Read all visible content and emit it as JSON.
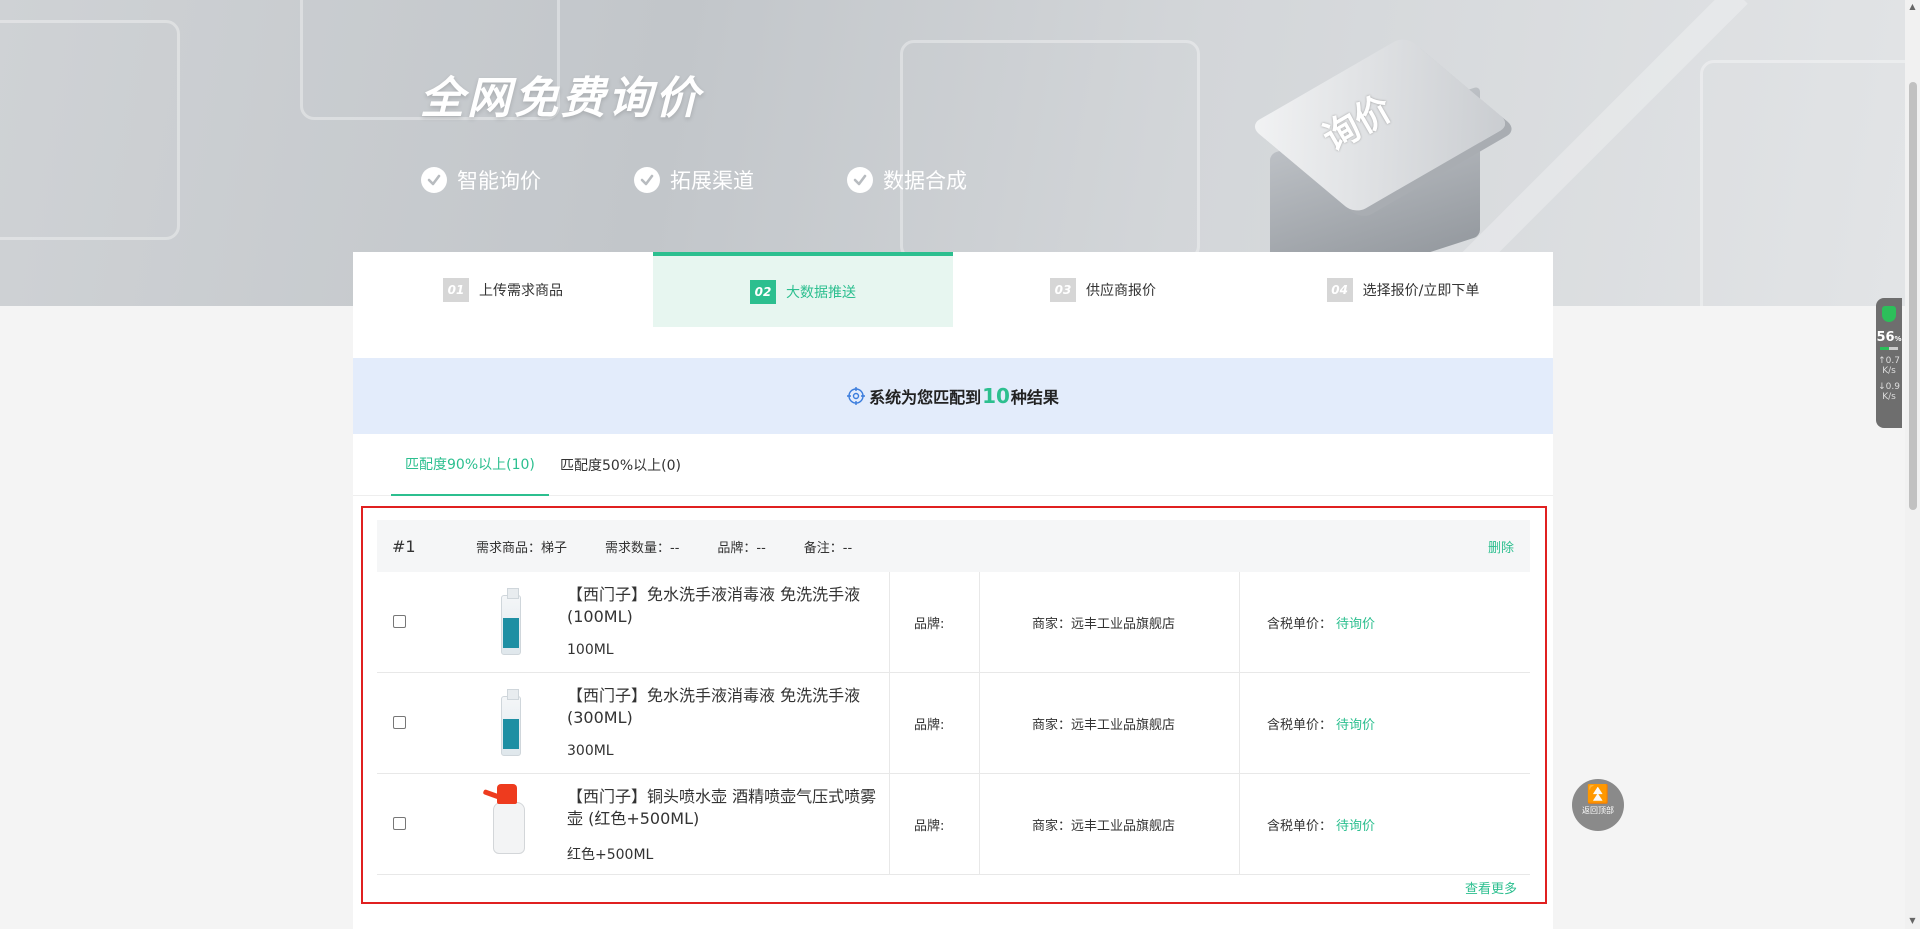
{
  "banner": {
    "title": "全网免费询价",
    "features": [
      "智能询价",
      "拓展渠道",
      "数据合成"
    ],
    "chip_label": "询价"
  },
  "steps": [
    {
      "num": "01",
      "label": "上传需求商品",
      "active": false
    },
    {
      "num": "02",
      "label": "大数据推送",
      "active": true
    },
    {
      "num": "03",
      "label": "供应商报价",
      "active": false
    },
    {
      "num": "04",
      "label": "选择报价/立即下单",
      "active": false
    }
  ],
  "match": {
    "prefix": "系统为您匹配到",
    "count": "10",
    "suffix": "种结果"
  },
  "tabs": [
    {
      "label": "匹配度90%以上(10)",
      "active": true
    },
    {
      "label": "匹配度50%以上(0)",
      "active": false
    }
  ],
  "request": {
    "index": "#1",
    "product": "需求商品：梯子",
    "quantity": "需求数量：--",
    "brand": "品牌：--",
    "note": "备注：--",
    "delete_label": "删除"
  },
  "products": [
    {
      "title": "【西门子】免水洗手液消毒液 免洗洗手液(100ML)",
      "spec": "100ML",
      "brand": "品牌:",
      "merchant": "商家：远丰工业品旗舰店",
      "price_label": "含税单价：",
      "price_value": "待询价",
      "image": "sanitizer-bottle"
    },
    {
      "title": "【西门子】免水洗手液消毒液 免洗洗手液(300ML)",
      "spec": "300ML",
      "brand": "品牌:",
      "merchant": "商家：远丰工业品旗舰店",
      "price_label": "含税单价：",
      "price_value": "待询价",
      "image": "sanitizer-bottle"
    },
    {
      "title": "【西门子】铜头喷水壶 酒精喷壶气压式喷雾壶 (红色+500ML)",
      "spec": "红色+500ML",
      "brand": "品牌:",
      "merchant": "商家：远丰工业品旗舰店",
      "price_label": "含税单价：",
      "price_value": "待询价",
      "image": "spray-bottle"
    }
  ],
  "more_label": "查看更多",
  "widgets": {
    "monitor_percent": "56",
    "monitor_percent_unit": "%",
    "upload_speed": "0.7",
    "download_speed": "0.9",
    "speed_unit": "K/s",
    "back_to_top": "返回顶部"
  },
  "colors": {
    "accent": "#2cbf8f",
    "highlight_border": "#e02020",
    "match_banner_bg": "#e3ecfb"
  }
}
